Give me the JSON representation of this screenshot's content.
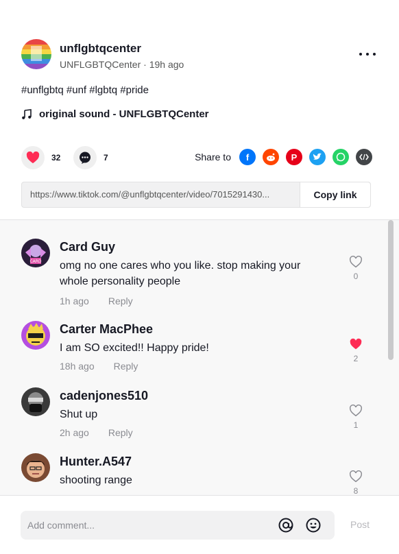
{
  "post": {
    "author_username": "unflgbtqcenter",
    "author_display": "UNFLGBTQCenter",
    "time": "19h ago",
    "author_sub_sep": " · ",
    "hashtags": "#unflgbtq #unf #lgbtq #pride",
    "sound": "original sound - UNFLGBTQCenter",
    "likes": "32",
    "comments_count": "7",
    "share_label": "Share to",
    "share_targets": [
      "facebook-icon",
      "reddit-icon",
      "pinterest-icon",
      "twitter-icon",
      "whatsapp-icon",
      "embed-icon"
    ],
    "link_url": "https://www.tiktok.com/@unflgbtqcenter/video/7015291430...",
    "copy_link_label": "Copy link"
  },
  "colors": {
    "like_red": "#fe2c55",
    "facebook": "#0075fa",
    "reddit": "#ff4500",
    "pinterest": "#e60019",
    "twitter": "#1da1f2",
    "whatsapp": "#25d366",
    "embed": "#424548"
  },
  "comments": [
    {
      "name": "Card Guy",
      "text": "omg no one cares who you like. stop making your whole personality people",
      "time": "1h ago",
      "reply": "Reply",
      "likes": "0",
      "liked": false
    },
    {
      "name": "Carter MacPhee",
      "text": "I am SO excited!! Happy pride!",
      "time": "18h ago",
      "reply": "Reply",
      "likes": "2",
      "liked": true
    },
    {
      "name": "cadenjones510",
      "text": "Shut up",
      "time": "2h ago",
      "reply": "Reply",
      "likes": "1",
      "liked": false
    },
    {
      "name": "Hunter.A547",
      "text": "shooting range",
      "time": "",
      "reply": "",
      "likes": "8",
      "liked": false
    }
  ],
  "composer": {
    "placeholder": "Add comment...",
    "post_label": "Post"
  }
}
